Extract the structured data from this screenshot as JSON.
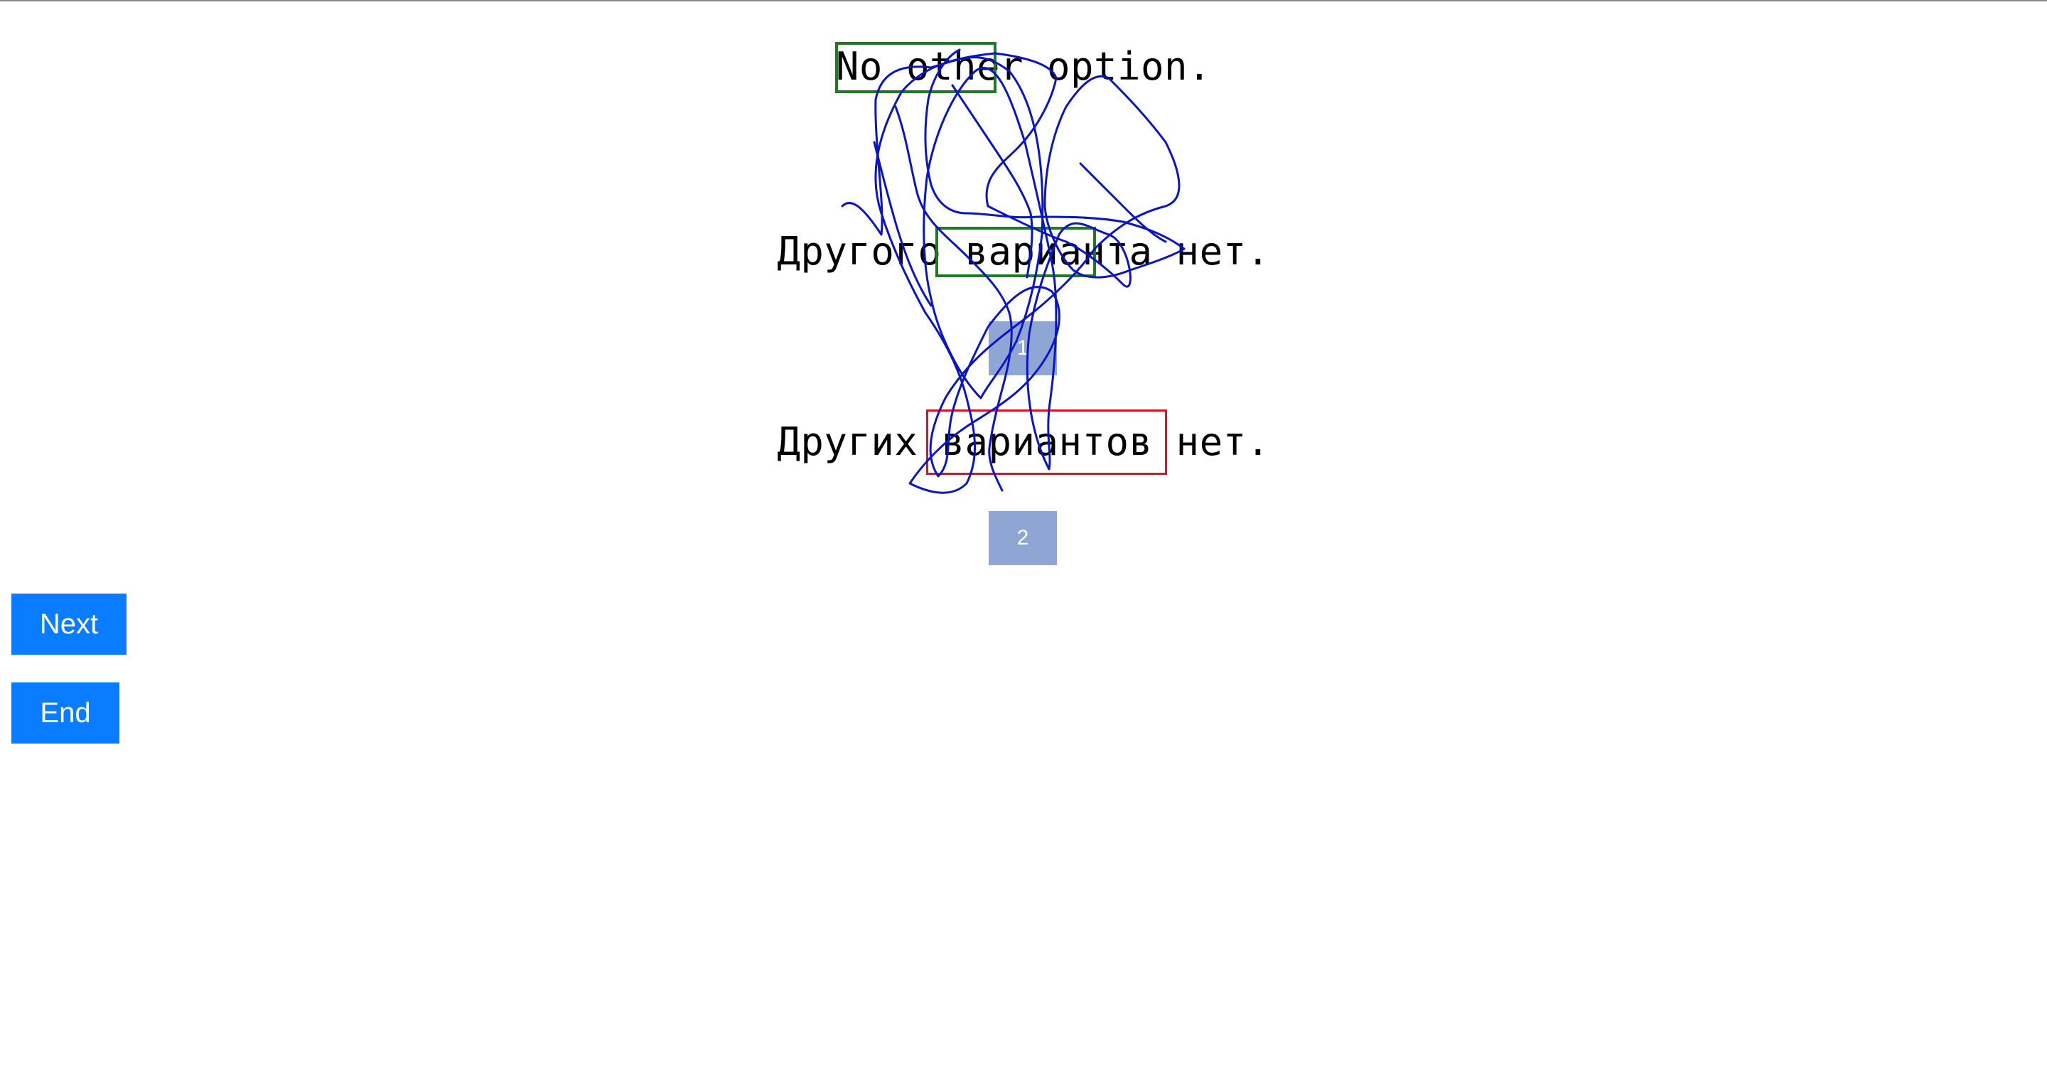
{
  "sentences": {
    "source": "No other option.",
    "candidate_1": "Другого варианта нет.",
    "candidate_2": "Других вариантов нет."
  },
  "highlights": {
    "source_phrase": "No other",
    "candidate_1_phrase": "варианта",
    "candidate_2_phrase": "вариантов"
  },
  "badges": {
    "candidate_1_number": "1",
    "candidate_2_number": "2"
  },
  "buttons": {
    "next_label": "Next",
    "end_label": "End"
  },
  "colors": {
    "match_box": "#1e7b1e",
    "mismatch_box": "#e0102a",
    "trace_stroke": "#0a14c8",
    "badge": "#8fa6d4",
    "button": "#0a7cff"
  }
}
